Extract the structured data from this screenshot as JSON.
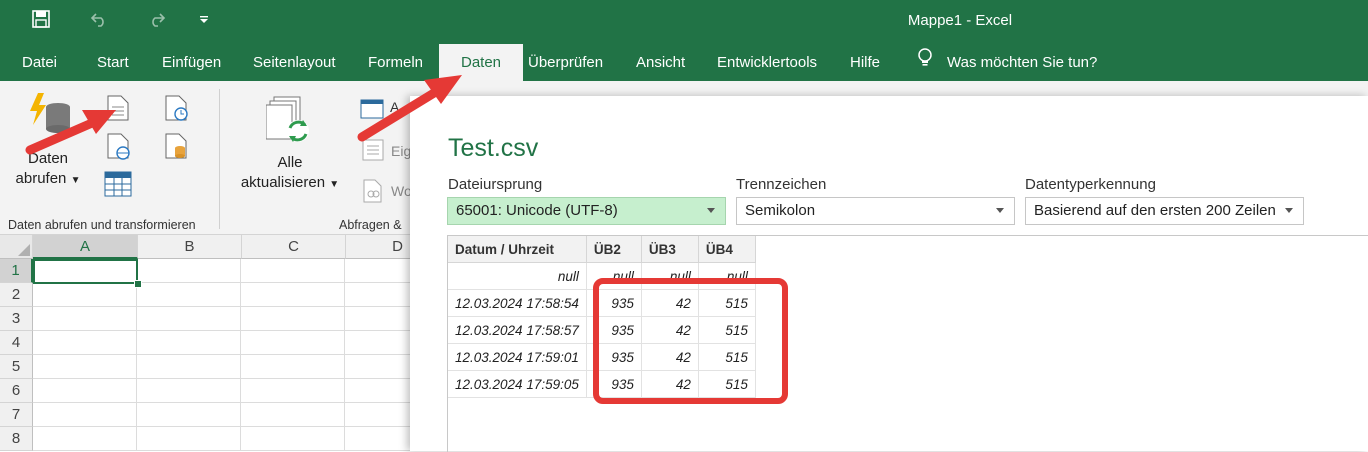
{
  "window": {
    "title": "Mappe1  -  Excel"
  },
  "tabs": [
    "Datei",
    "Start",
    "Einfügen",
    "Seitenlayout",
    "Formeln",
    "Daten",
    "Überprüfen",
    "Ansicht",
    "Entwicklertools",
    "Hilfe"
  ],
  "active_tab": "Daten",
  "tell_me": "Was möchten Sie tun?",
  "ribbon": {
    "get_data_line1": "Daten",
    "get_data_line2": "abrufen",
    "group1_label": "Daten abrufen und transformieren",
    "refresh_line1": "Alle",
    "refresh_line2": "aktualisieren",
    "group2_label": "Abfragen &",
    "partial_1": "A",
    "partial_2": "Eig",
    "partial_3": "Wo"
  },
  "sheet": {
    "columns": [
      "A",
      "B",
      "C",
      "D"
    ],
    "rows": [
      "1",
      "2",
      "3",
      "4",
      "5",
      "6",
      "7",
      "8"
    ]
  },
  "dialog": {
    "title": "Test.csv",
    "origin_label": "Dateiursprung",
    "origin_value": "65001: Unicode (UTF-8)",
    "delimiter_label": "Trennzeichen",
    "delimiter_value": "Semikolon",
    "detect_label": "Datentyperkennung",
    "detect_value": "Basierend auf den ersten 200 Zeilen",
    "table": {
      "headers": [
        "Datum / Uhrzeit",
        "ÜB2",
        "ÜB3",
        "ÜB4"
      ],
      "rows": [
        [
          "null",
          "null",
          "null",
          "null"
        ],
        [
          "12.03.2024 17:58:54",
          "935",
          "42",
          "515"
        ],
        [
          "12.03.2024 17:58:57",
          "935",
          "42",
          "515"
        ],
        [
          "12.03.2024 17:59:01",
          "935",
          "42",
          "515"
        ],
        [
          "12.03.2024 17:59:05",
          "935",
          "42",
          "515"
        ]
      ]
    }
  },
  "colors": {
    "excel_green": "#217346",
    "highlight_red": "#e53935"
  }
}
